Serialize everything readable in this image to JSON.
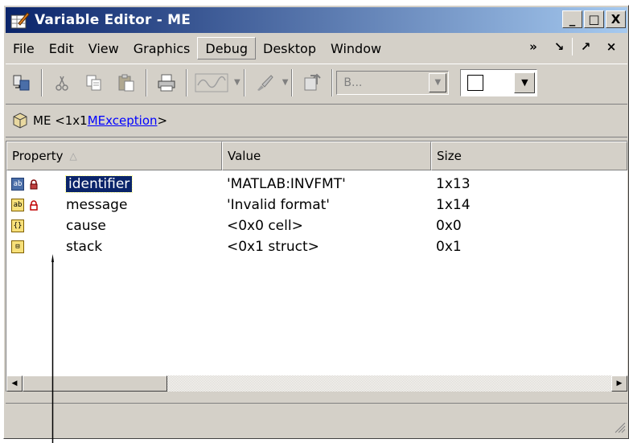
{
  "window": {
    "title": "Variable Editor - ME",
    "buttons": {
      "minimize": "_",
      "maximize": "□",
      "close": "X"
    }
  },
  "menu": {
    "items": [
      "File",
      "Edit",
      "View",
      "Graphics",
      "Debug",
      "Desktop",
      "Window"
    ],
    "active": "Debug",
    "right_glyphs": [
      "»",
      "↘",
      "↗",
      "×"
    ]
  },
  "toolbar": {
    "combo_text": "B...",
    "icons": [
      "import-icon",
      "cut-icon",
      "copy-icon",
      "paste-icon",
      "print-icon",
      "plot-icon",
      "brush-icon",
      "workspace-icon"
    ]
  },
  "path": {
    "variable": "ME <1x1 ",
    "class_link": "MException",
    "suffix": ">"
  },
  "table": {
    "headers": [
      "Property",
      "Value",
      "Size"
    ],
    "sort_glyph": "△",
    "rows": [
      {
        "type_icon": "ab",
        "locked": true,
        "name": "identifier",
        "value": "'MATLAB:INVFMT'",
        "size": "1x13",
        "selected": true
      },
      {
        "type_icon": "ab",
        "locked": true,
        "name": "message",
        "value": "'Invalid format'",
        "size": "1x14",
        "selected": false
      },
      {
        "type_icon": "{}",
        "locked": false,
        "name": "cause",
        "value": "<0x0 cell>",
        "size": "0x0",
        "selected": false
      },
      {
        "type_icon": "⊟",
        "locked": false,
        "name": "stack",
        "value": "<0x1 struct>",
        "size": "0x1",
        "selected": false
      }
    ]
  },
  "colors": {
    "title_gradient_start": "#0a246a",
    "selection": "#0a246a",
    "link": "#0000ff",
    "chrome": "#d4d0c8"
  }
}
